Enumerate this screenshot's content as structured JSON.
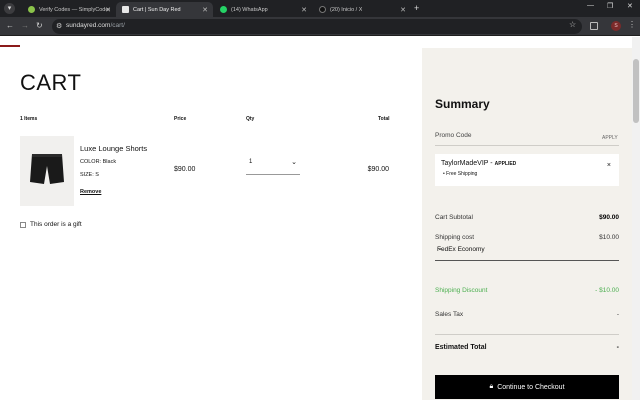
{
  "browser": {
    "tabs": [
      {
        "title": "Verify Codes — SimplyCodes",
        "color": "#8bc34a"
      },
      {
        "title": "Cart | Sun Day Red",
        "color": "#e8e8e8",
        "active": true
      },
      {
        "title": "(14) WhatsApp",
        "color": "#25d366"
      },
      {
        "title": "(20) Inicio / X",
        "color": "#222222"
      }
    ],
    "url_host": "sundayred.com",
    "url_path": "/cart/",
    "profile_initial": "S",
    "icons": {
      "menu": "▾",
      "new_tab": "+",
      "minimize": "—",
      "maximize": "❐",
      "close": "✕",
      "back": "←",
      "forward": "→",
      "reload": "↻",
      "site_info": "⚙",
      "star": "☆",
      "kebab": "⋮"
    }
  },
  "cart": {
    "title": "CART",
    "headers": {
      "items": "1 Items",
      "price": "Price",
      "qty": "Qty",
      "total": "Total"
    },
    "item": {
      "name": "Luxe Lounge Shorts",
      "color": "COLOR: Black",
      "size": "SIZE: S",
      "remove": "Remove",
      "price": "$90.00",
      "qty": "1",
      "total": "$90.00"
    },
    "gift_label": "This order is a gift"
  },
  "summary": {
    "title": "Summary",
    "promo_label": "Promo Code",
    "apply": "APPLY",
    "promo": {
      "code": "TaylorMadeVIP -",
      "status": "APPLIED",
      "benefit": "• Free Shipping",
      "remove_icon": "×"
    },
    "subtotal_label": "Cart Subtotal",
    "subtotal": "$90.00",
    "shipping_label": "Shipping cost",
    "shipping": "$10.00",
    "shipping_method": "FedEx Economy",
    "discount_label": "Shipping Discount",
    "discount": "- $10.00",
    "tax_label": "Sales Tax",
    "tax": "-",
    "est_label": "Estimated Total",
    "est": "-",
    "checkout": "Continue to Checkout"
  }
}
